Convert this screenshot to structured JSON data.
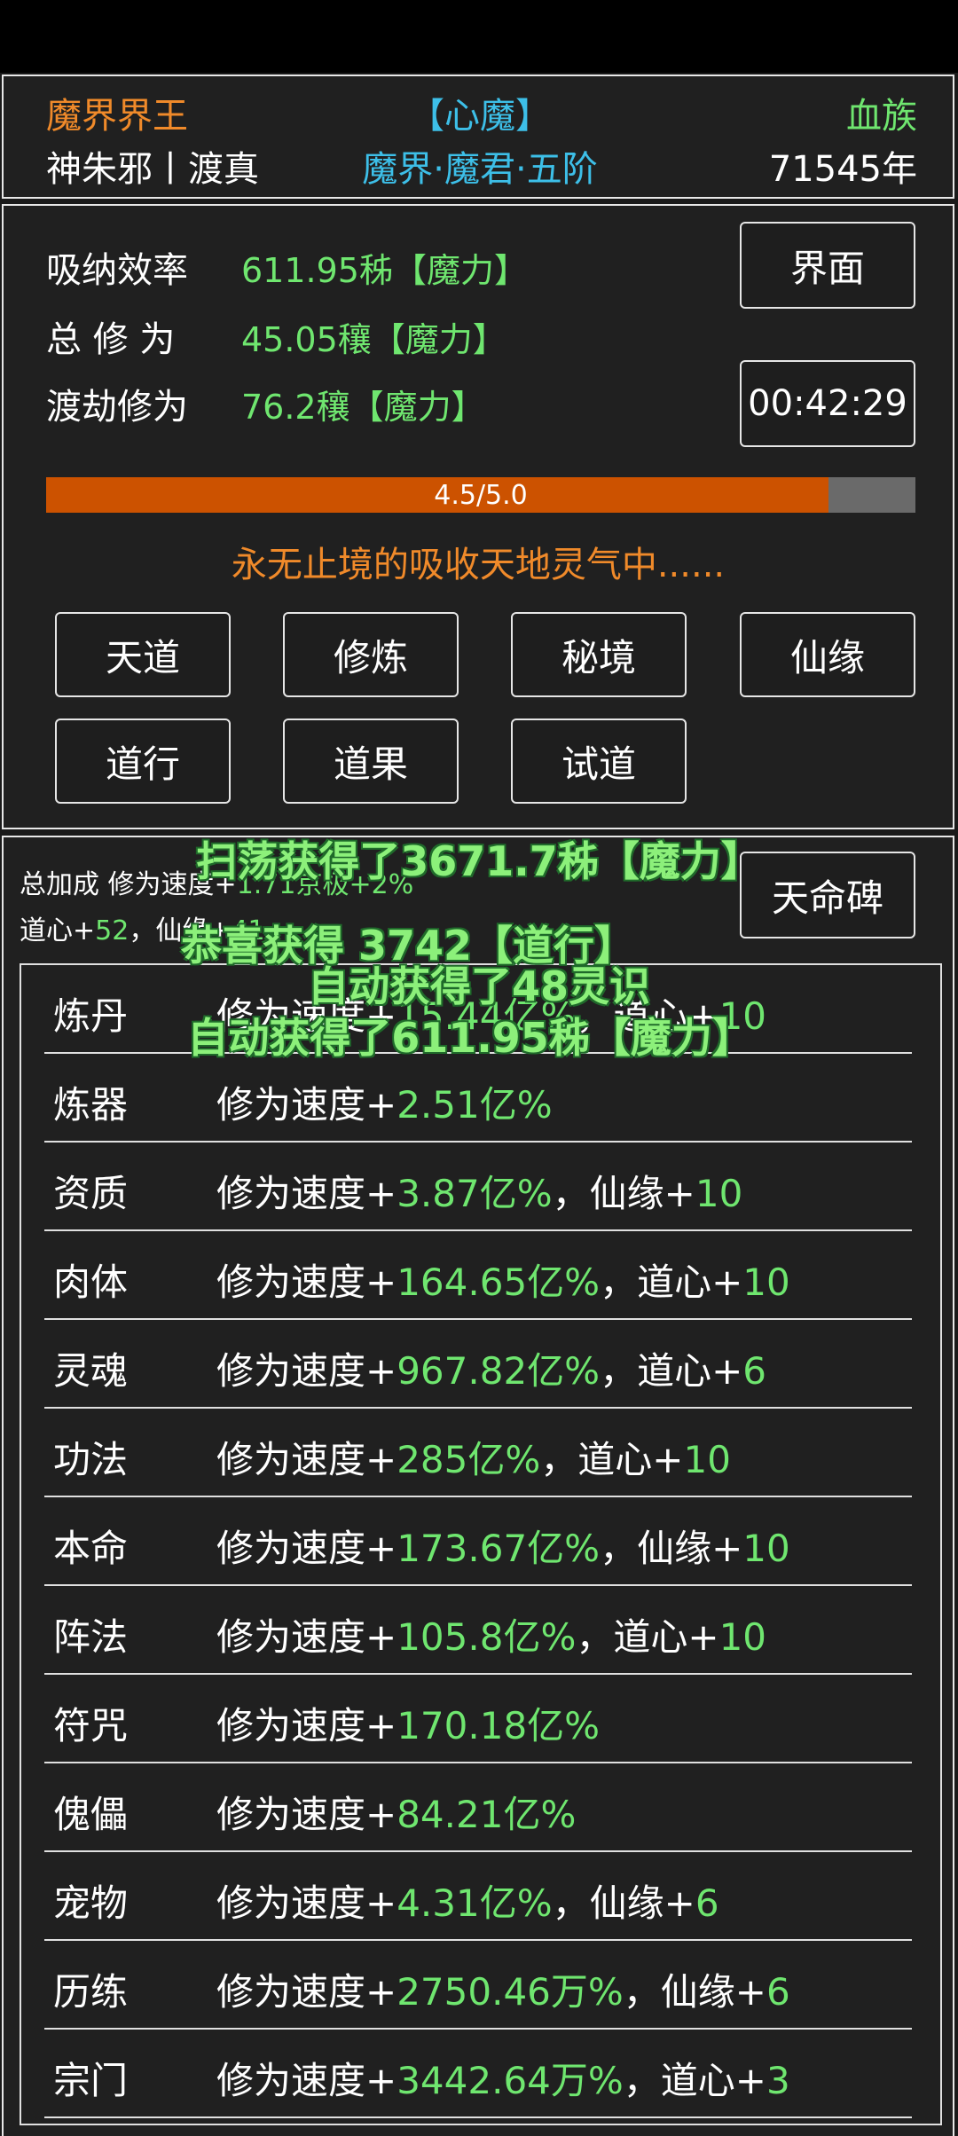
{
  "header": {
    "realm_title": "魔界界王",
    "heart_demon": "【心魔】",
    "race": "血族",
    "player_name": "神朱邪丨渡真",
    "rank": "魔界·魔君·五阶",
    "age": "71545年"
  },
  "cultivation": {
    "rows": [
      {
        "label": "吸纳效率",
        "value": "611.95秭【魔力】"
      },
      {
        "label": "总 修 为",
        "value": "45.05穰【魔力】"
      },
      {
        "label": "渡劫修为",
        "value": "76.2穰【魔力】"
      }
    ],
    "interface_button": "界面",
    "timer_button": "00:42:29",
    "progress": {
      "text": "4.5/5.0",
      "value": 4.5,
      "max": 5.0,
      "fill_color": "#cc5200"
    },
    "status_text": "永无止境的吸收天地灵气中......",
    "menu_buttons": [
      "天道",
      "修炼",
      "秘境",
      "仙缘",
      "道行",
      "道果",
      "试道"
    ]
  },
  "bonus": {
    "summary_prefix": "总加成 修为速度+",
    "summary_value": "1.71京极+2%",
    "line2_prefix": "道心+",
    "line2_daoxin": "52",
    "line2_mid": "，仙缘+",
    "line2_xianyuan": "41",
    "tianming_button": "天命碑",
    "items": [
      {
        "name": "炼丹",
        "prefix": "修为速度+",
        "value": "15.44亿%",
        "sep": "，道心+",
        "extra": "10"
      },
      {
        "name": "炼器",
        "prefix": "修为速度+",
        "value": "2.51亿%",
        "sep": "",
        "extra": ""
      },
      {
        "name": "资质",
        "prefix": "修为速度+",
        "value": "3.87亿%",
        "sep": "，仙缘+",
        "extra": "10"
      },
      {
        "name": "肉体",
        "prefix": "修为速度+",
        "value": "164.65亿%",
        "sep": "，道心+",
        "extra": "10"
      },
      {
        "name": "灵魂",
        "prefix": "修为速度+",
        "value": "967.82亿%",
        "sep": "，道心+",
        "extra": "6"
      },
      {
        "name": "功法",
        "prefix": "修为速度+",
        "value": "285亿%",
        "sep": "，道心+",
        "extra": "10"
      },
      {
        "name": "本命",
        "prefix": "修为速度+",
        "value": "173.67亿%",
        "sep": "，仙缘+",
        "extra": "10"
      },
      {
        "name": "阵法",
        "prefix": "修为速度+",
        "value": "105.8亿%",
        "sep": "，道心+",
        "extra": "10"
      },
      {
        "name": "符咒",
        "prefix": "修为速度+",
        "value": "170.18亿%",
        "sep": "",
        "extra": ""
      },
      {
        "name": "傀儡",
        "prefix": "修为速度+",
        "value": "84.21亿%",
        "sep": "",
        "extra": ""
      },
      {
        "name": "宠物",
        "prefix": "修为速度+",
        "value": "4.31亿%",
        "sep": "，仙缘+",
        "extra": "6"
      },
      {
        "name": "历练",
        "prefix": "修为速度+",
        "value": "2750.46万%",
        "sep": "，仙缘+",
        "extra": "6"
      },
      {
        "name": "宗门",
        "prefix": "修为速度+",
        "value": "3442.64万%",
        "sep": "，道心+",
        "extra": "3"
      }
    ]
  },
  "notifications": [
    "扫荡获得了3671.7秭【魔力】",
    "恭喜获得 3742【道行】",
    "自动获得了48灵识",
    "自动获得了611.95秭【魔力】"
  ]
}
